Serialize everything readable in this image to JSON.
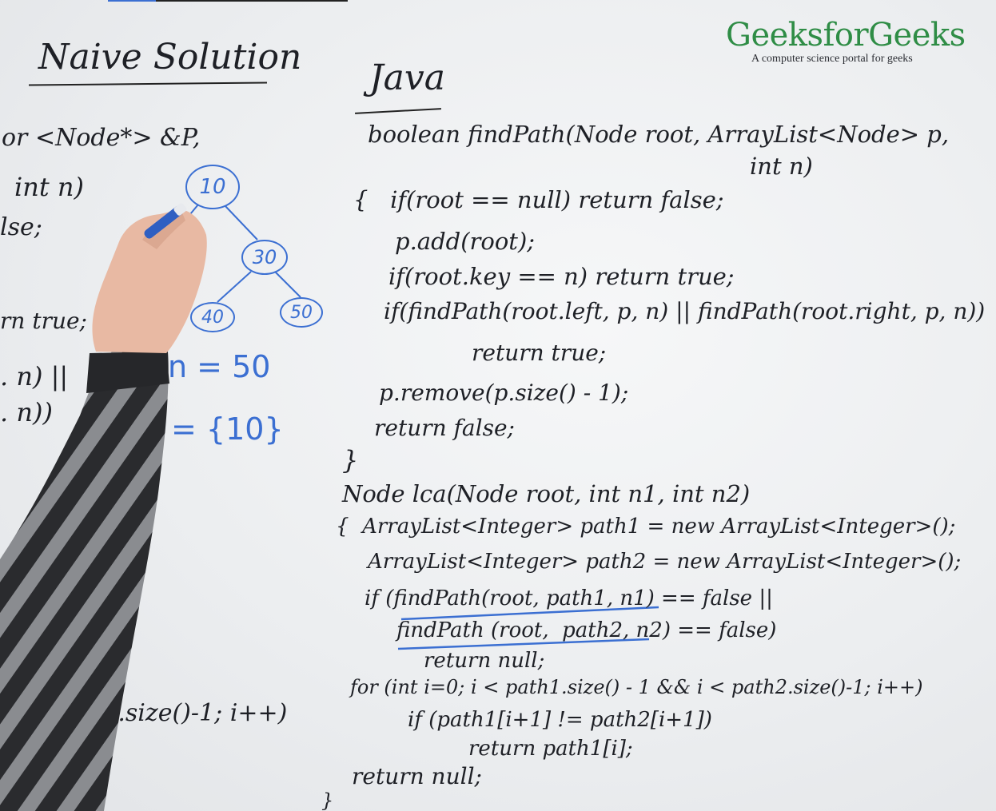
{
  "logo": {
    "name": "GeeksforGeeks",
    "tagline": "A computer science portal for geeks"
  },
  "left_panel": {
    "heading": "Naive Solution",
    "code_fragments": [
      "or <Node*> &P,",
      "int n)",
      "lse;",
      "rn true;",
      ". n) ||",
      ". n))",
      "}",
      "i < path2.size()-1; i++)",
      ")"
    ]
  },
  "tree": {
    "nodes": [
      "10",
      "30",
      "40",
      "50"
    ],
    "n_label": "n = 50",
    "path_label": "= {10}"
  },
  "java": {
    "heading": "Java",
    "lines": [
      "boolean findPath(Node root, ArrayList<Node> p,",
      "int n)",
      "{   if(root == null) return false;",
      "p.add(root);",
      "if(root.key == n) return true;",
      "if(findPath(root.left, p, n) || findPath(root.right, p, n))",
      "return true;",
      "p.remove(p.size() - 1);",
      "return false;",
      "}",
      "Node lca(Node root, int n1, int n2)",
      "{  ArrayList<Integer> path1 = new ArrayList<Integer>();",
      "ArrayList<Integer> path2 = new ArrayList<Integer>();",
      "if (findPath(root, path1, n1) == false ||",
      "findPath (root,  path2, n2) == false)",
      "return null;",
      "for (int i=0; i < path1.size() - 1 && i < path2.size()-1; i++)",
      "if (path1[i+1] != path2[i+1])",
      "return path1[i];",
      "return null;",
      "}"
    ]
  },
  "colors": {
    "board": "#eceef0",
    "ink": "#1e2026",
    "marker_blue": "#3b6fd2",
    "logo_green": "#2f8d46",
    "sleeve_dark": "#2a2b2e",
    "sleeve_light": "#8a8c90",
    "skin": "#e8b9a3"
  }
}
